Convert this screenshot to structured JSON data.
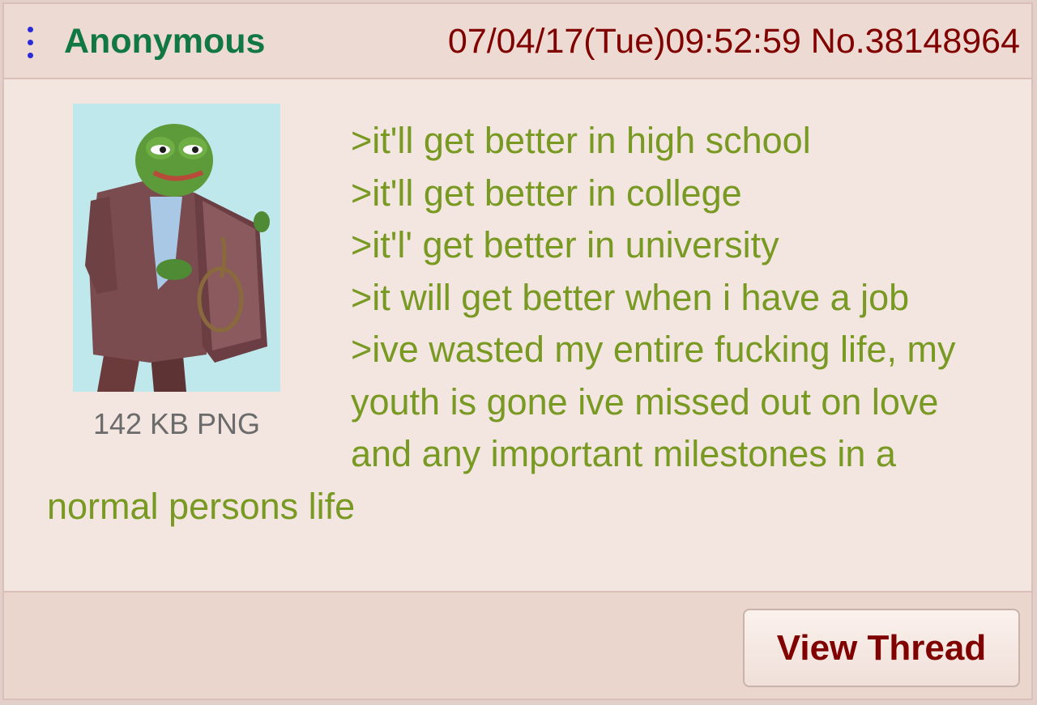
{
  "post": {
    "name": "Anonymous",
    "datetime": "07/04/17(Tue)09:52:59",
    "number": "No.38148964",
    "file_info": "142 KB PNG",
    "lines": [
      ">it'll get better in high school",
      ">it'll get better in college",
      ">it'l' get better in university",
      ">it will get better when i have a job",
      ">ive wasted my entire fucking life, my youth is gone ive missed out on love and any important milestones in a normal persons life"
    ]
  },
  "actions": {
    "view_thread": "View Thread"
  },
  "colors": {
    "name": "#117743",
    "meta": "#800000",
    "greentext": "#789922",
    "background": "#f0e0d6",
    "menu_dots": "#2b2bd9"
  },
  "icons": {
    "menu": "vertical-ellipsis-icon",
    "thumbnail": "frog-in-suit-with-noose-illustration"
  }
}
